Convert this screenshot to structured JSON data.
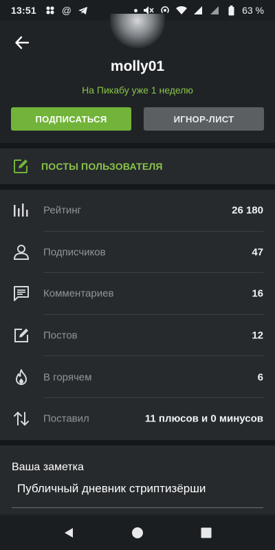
{
  "status_bar": {
    "time": "13:51",
    "battery": "63 %",
    "left_icons": [
      "dots-grid-icon",
      "at-icon",
      "telegram-icon"
    ],
    "right_icons": [
      "dot-icon",
      "mute-icon",
      "hotspot-icon",
      "wifi-icon",
      "signal-icon",
      "signal2-icon",
      "battery-icon"
    ]
  },
  "profile": {
    "username": "molly01",
    "since": "На Пикабу уже 1 неделю",
    "subscribe_label": "ПОДПИСАТЬСЯ",
    "ignore_label": "ИГНОР-ЛИСТ"
  },
  "posts": {
    "label": "ПОСТЫ ПОЛЬЗОВАТЕЛЯ"
  },
  "stats": [
    {
      "name": "Рейтинг",
      "value": "26 180",
      "icon": "rating-bars-icon"
    },
    {
      "name": "Подписчиков",
      "value": "47",
      "icon": "person-icon"
    },
    {
      "name": "Комментариев",
      "value": "16",
      "icon": "comment-icon"
    },
    {
      "name": "Постов",
      "value": "12",
      "icon": "edit-icon"
    },
    {
      "name": "В горячем",
      "value": "6",
      "icon": "fire-icon"
    },
    {
      "name": "Поставил",
      "value": "11 плюсов и 0 минусов",
      "icon": "sort-arrows-icon"
    }
  ],
  "note": {
    "title": "Ваша заметка",
    "text": "Публичный дневник стриптизёрши"
  },
  "colors": {
    "accent_green": "#72b43a",
    "background": "#1f2326",
    "card": "#262a2d"
  }
}
